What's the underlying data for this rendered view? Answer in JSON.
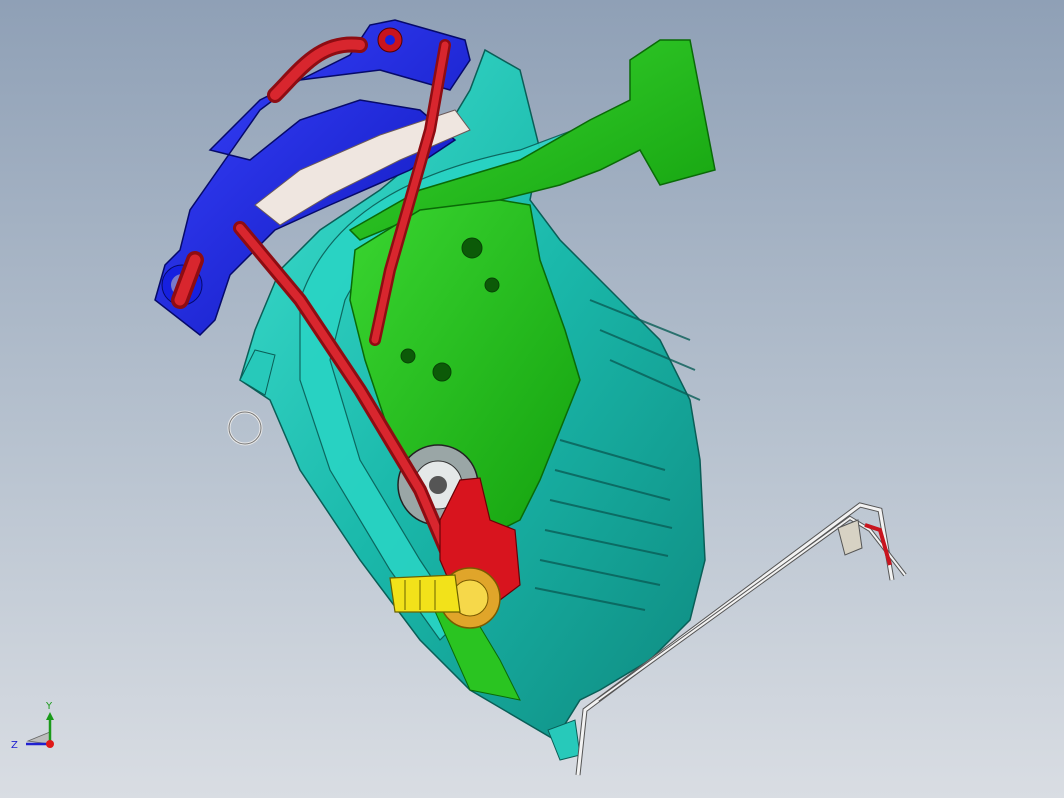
{
  "viewport": {
    "background_top": "#8fa0b6",
    "background_bottom": "#d9dde3"
  },
  "colors": {
    "housing": "#1fc2b3",
    "housing_dark": "#0f8f86",
    "inner_panel": "#22c21a",
    "blue_part": "#1620e0",
    "red_tube": "#c8141e",
    "yellow_connector": "#f2e21a",
    "bracket": "#eeeeee"
  },
  "axis_triad": {
    "y_label": "Y",
    "z_label": "Z",
    "icon": "coordinate-triad-icon"
  },
  "model_parts": [
    {
      "name": "blower-housing",
      "icon": "housing"
    },
    {
      "name": "green-inner-panel",
      "icon": "panel"
    },
    {
      "name": "blue-motor-cover",
      "icon": "cover"
    },
    {
      "name": "red-hose",
      "icon": "tube"
    },
    {
      "name": "yellow-connector",
      "icon": "connector"
    },
    {
      "name": "wire-bracket",
      "icon": "bracket"
    }
  ]
}
